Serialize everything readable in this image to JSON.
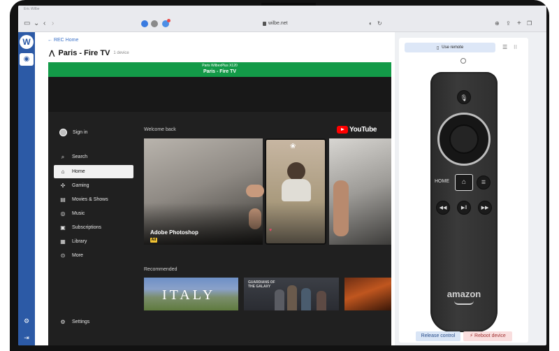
{
  "browser": {
    "tab_label": "Eric Wilbe",
    "url": "wilbe.net"
  },
  "rail": {
    "logo": "W"
  },
  "main": {
    "back_link": "← REC Home",
    "device_name": "Paris - Fire TV",
    "device_count": "1 device",
    "banner_small": "Paris WilbexPlus X120",
    "banner_main": "Paris - Fire TV"
  },
  "youtube": {
    "sign_in": "Sign in",
    "nav": [
      "Search",
      "Home",
      "Gaming",
      "Movies & Shows",
      "Music",
      "Subscriptions",
      "Library",
      "More"
    ],
    "settings": "Settings",
    "welcome": "Welcome back",
    "logo_text": "YouTube",
    "featured_title": "Adobe Photoshop",
    "ad_badge": "Ad",
    "recommended": "Recommended",
    "rec_italy": "ITALY",
    "rec_galaxy": "GUARDIANS OF THE GALAXY"
  },
  "remote_panel": {
    "use_remote": "Use remote",
    "home_label": "HOME",
    "brand": "amazon",
    "release_control": "Release control",
    "reboot_device": "Reboot device"
  },
  "colors": {
    "rail": "#2c5aa6",
    "banner": "#139a48",
    "accent_link": "#3970c8"
  }
}
